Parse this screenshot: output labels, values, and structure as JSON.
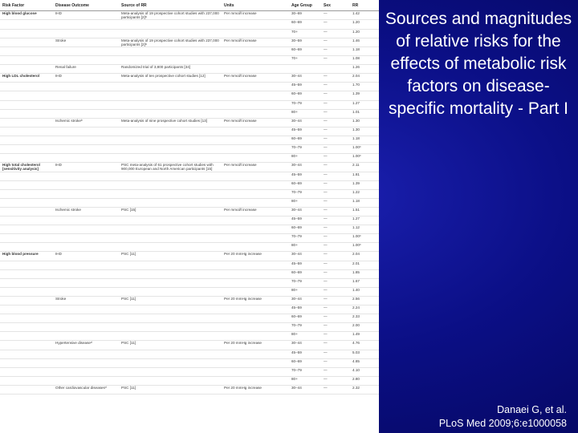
{
  "slide": {
    "title": "Sources and magnitudes of relative risks for the effects of metabolic risk factors on disease-specific mortality - Part I",
    "citation_line1": "Danaei G, et al.",
    "citation_line2": "PLoS Med 2009;6:e1000058"
  },
  "table": {
    "headers": [
      "Risk Factor",
      "Disease Outcome",
      "Source of RR",
      "Units",
      "Age Group",
      "Sex",
      "RR"
    ],
    "rows": [
      [
        "High blood glucose",
        "IHD",
        "Meta-analysis of 19 prospective cohort studies with 237,000 participants [2]ᵃ",
        "Per mmol/l increase",
        "30–69",
        "—",
        "1.42"
      ],
      [
        "",
        "",
        "",
        "",
        "60–69",
        "—",
        "1.20"
      ],
      [
        "",
        "",
        "",
        "",
        "70+",
        "—",
        "1.20"
      ],
      [
        "",
        "Stroke",
        "Meta-analysis of 19 prospective cohort studies with 237,000 participants [2]ᵃ",
        "Per mmol/l increase",
        "30–59",
        "—",
        "1.46"
      ],
      [
        "",
        "",
        "",
        "",
        "60–69",
        "—",
        "1.18"
      ],
      [
        "",
        "",
        "",
        "",
        "70+",
        "—",
        "1.08"
      ],
      [
        "",
        "Renal failure",
        "Randomized trial of 3,800 participants [34]",
        "",
        "",
        "",
        "1.26"
      ],
      [
        "High LDL cholesterol",
        "IHD",
        "Meta-analysis of ten prospective cohort studies [12]",
        "Per mmol/l increase",
        "30–44",
        "—",
        "2.04"
      ],
      [
        "",
        "",
        "",
        "",
        "45–59",
        "—",
        "1.70"
      ],
      [
        "",
        "",
        "",
        "",
        "60–69",
        "—",
        "1.39"
      ],
      [
        "",
        "",
        "",
        "",
        "70–79",
        "—",
        "1.27"
      ],
      [
        "",
        "",
        "",
        "",
        "80+",
        "—",
        "1.01"
      ],
      [
        "",
        "Ischemic strokeᵇ",
        "Meta-analysis of nine prospective cohort studies [13]",
        "Per mmol/l increase",
        "30–44",
        "—",
        "1.30"
      ],
      [
        "",
        "",
        "",
        "",
        "45–59",
        "—",
        "1.30"
      ],
      [
        "",
        "",
        "",
        "",
        "60–69",
        "—",
        "1.18"
      ],
      [
        "",
        "",
        "",
        "",
        "70–79",
        "—",
        "1.00ᶜ"
      ],
      [
        "",
        "",
        "",
        "",
        "80+",
        "—",
        "1.00ᶜ"
      ],
      [
        "High total cholesterol [sensitivity analysis]",
        "IHD",
        "PSC meta-analysis of 61 prospective cohort studies with 900,000 European and North American participants [15]",
        "Per mmol/l increase",
        "30–44",
        "—",
        "2.11"
      ],
      [
        "",
        "",
        "",
        "",
        "45–59",
        "—",
        "1.81"
      ],
      [
        "",
        "",
        "",
        "",
        "60–69",
        "—",
        "1.39"
      ],
      [
        "",
        "",
        "",
        "",
        "70–79",
        "—",
        "1.22"
      ],
      [
        "",
        "",
        "",
        "",
        "80+",
        "—",
        "1.18"
      ],
      [
        "",
        "Ischemic stroke",
        "PSC [15]",
        "Per mmol/l increase",
        "30–44",
        "—",
        "1.51"
      ],
      [
        "",
        "",
        "",
        "",
        "45–59",
        "—",
        "1.27"
      ],
      [
        "",
        "",
        "",
        "",
        "60–69",
        "—",
        "1.12"
      ],
      [
        "",
        "",
        "",
        "",
        "70–79",
        "—",
        "1.00ᶜ"
      ],
      [
        "",
        "",
        "",
        "",
        "80+",
        "—",
        "1.00ᶜ"
      ],
      [
        "High blood pressure",
        "IHD",
        "PSC [11]",
        "Per 20 mmHg increase",
        "30–44",
        "—",
        "2.04"
      ],
      [
        "",
        "",
        "",
        "",
        "45–59",
        "—",
        "2.01"
      ],
      [
        "",
        "",
        "",
        "",
        "60–69",
        "—",
        "1.85"
      ],
      [
        "",
        "",
        "",
        "",
        "70–79",
        "—",
        "1.67"
      ],
      [
        "",
        "",
        "",
        "",
        "80+",
        "—",
        "1.40"
      ],
      [
        "",
        "Stroke",
        "PSC [11]",
        "Per 20 mmHg increase",
        "30–44",
        "—",
        "2.56"
      ],
      [
        "",
        "",
        "",
        "",
        "45–59",
        "—",
        "2.24"
      ],
      [
        "",
        "",
        "",
        "",
        "60–69",
        "—",
        "2.33"
      ],
      [
        "",
        "",
        "",
        "",
        "70–79",
        "—",
        "2.00"
      ],
      [
        "",
        "",
        "",
        "",
        "80+",
        "—",
        "1.49"
      ],
      [
        "",
        "Hypertensive diseaseᵈ",
        "PSC [11]",
        "Per 20 mmHg increase",
        "30–44",
        "—",
        "4.76"
      ],
      [
        "",
        "",
        "",
        "",
        "45–59",
        "—",
        "5.03"
      ],
      [
        "",
        "",
        "",
        "",
        "60–69",
        "—",
        "4.85"
      ],
      [
        "",
        "",
        "",
        "",
        "70–79",
        "—",
        "4.10"
      ],
      [
        "",
        "",
        "",
        "",
        "80+",
        "—",
        "2.80"
      ],
      [
        "",
        "Other cardiovascular diseasesᵈ",
        "PSC [11]",
        "Per 20 mmHg increase",
        "30–44",
        "—",
        "2.32"
      ]
    ]
  }
}
